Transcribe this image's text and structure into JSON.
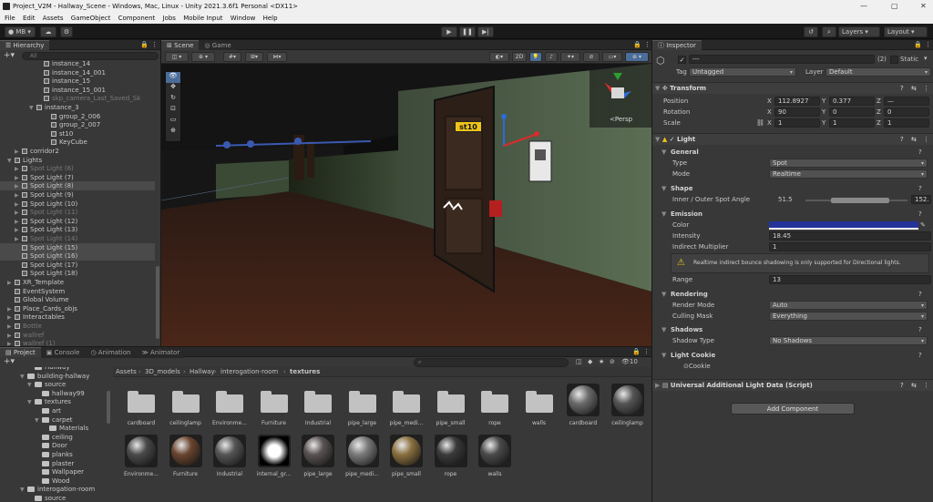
{
  "window": {
    "title": "Project_V2M - Hallway_Scene - Windows, Mac, Linux - Unity 2021.3.6f1 Personal <DX11>"
  },
  "menu": [
    "File",
    "Edit",
    "Assets",
    "GameObject",
    "Component",
    "Jobs",
    "Mobile Input",
    "Window",
    "Help"
  ],
  "toolbar": {
    "account": "MB",
    "layers": "Layers",
    "layout": "Layout"
  },
  "hierarchy": {
    "tab": "Hierarchy",
    "search_placeholder": "All",
    "rows": [
      {
        "label": "instance_14",
        "depth": 6,
        "icon": true,
        "dim": false,
        "sel": false,
        "arrow": ""
      },
      {
        "label": "instance_14_001",
        "depth": 6,
        "icon": true,
        "dim": false,
        "sel": false,
        "arrow": ""
      },
      {
        "label": "instance_15",
        "depth": 6,
        "icon": true,
        "dim": false,
        "sel": false,
        "arrow": ""
      },
      {
        "label": "instance_15_001",
        "depth": 6,
        "icon": true,
        "dim": false,
        "sel": false,
        "arrow": ""
      },
      {
        "label": "skp_camera_Last_Saved_Sk",
        "depth": 6,
        "icon": true,
        "dim": true,
        "sel": false,
        "arrow": ""
      },
      {
        "label": "instance_3",
        "depth": 5,
        "icon": true,
        "dim": false,
        "sel": false,
        "arrow": "▼"
      },
      {
        "label": "group_2_006",
        "depth": 7,
        "icon": true,
        "dim": false,
        "sel": false,
        "arrow": ""
      },
      {
        "label": "group_2_007",
        "depth": 7,
        "icon": true,
        "dim": false,
        "sel": false,
        "arrow": ""
      },
      {
        "label": "st10",
        "depth": 7,
        "icon": true,
        "dim": false,
        "sel": false,
        "arrow": ""
      },
      {
        "label": "KeyCube",
        "depth": 7,
        "icon": true,
        "dim": false,
        "sel": false,
        "arrow": ""
      },
      {
        "label": "corridor2",
        "depth": 3,
        "icon": true,
        "dim": false,
        "sel": false,
        "arrow": "▶"
      },
      {
        "label": "Lights",
        "depth": 2,
        "icon": true,
        "dim": false,
        "sel": false,
        "arrow": "▼"
      },
      {
        "label": "Spot Light (6)",
        "depth": 3,
        "icon": true,
        "dim": true,
        "sel": false,
        "arrow": "▶"
      },
      {
        "label": "Spot Light (7)",
        "depth": 3,
        "icon": true,
        "dim": false,
        "sel": false,
        "arrow": "▶"
      },
      {
        "label": "Spot Light (8)",
        "depth": 3,
        "icon": true,
        "dim": false,
        "sel": true,
        "arrow": "▶"
      },
      {
        "label": "Spot Light (9)",
        "depth": 3,
        "icon": true,
        "dim": false,
        "sel": false,
        "arrow": "▶"
      },
      {
        "label": "Spot Light (10)",
        "depth": 3,
        "icon": true,
        "dim": false,
        "sel": false,
        "arrow": "▶"
      },
      {
        "label": "Spot Light (11)",
        "depth": 3,
        "icon": true,
        "dim": true,
        "sel": false,
        "arrow": "▶"
      },
      {
        "label": "Spot Light (12)",
        "depth": 3,
        "icon": true,
        "dim": false,
        "sel": false,
        "arrow": "▶"
      },
      {
        "label": "Spot Light (13)",
        "depth": 3,
        "icon": true,
        "dim": false,
        "sel": false,
        "arrow": "▶"
      },
      {
        "label": "Spot Light (14)",
        "depth": 3,
        "icon": true,
        "dim": true,
        "sel": false,
        "arrow": "▶"
      },
      {
        "label": "Spot Light (15)",
        "depth": 3,
        "icon": true,
        "dim": false,
        "sel": true,
        "arrow": ""
      },
      {
        "label": "Spot Light (16)",
        "depth": 3,
        "icon": true,
        "dim": false,
        "sel": true,
        "arrow": ""
      },
      {
        "label": "Spot Light (17)",
        "depth": 3,
        "icon": true,
        "dim": false,
        "sel": false,
        "arrow": ""
      },
      {
        "label": "Spot Light (18)",
        "depth": 3,
        "icon": true,
        "dim": false,
        "sel": false,
        "arrow": ""
      },
      {
        "label": "XR_Template",
        "depth": 2,
        "icon": true,
        "dim": false,
        "sel": false,
        "arrow": "▶"
      },
      {
        "label": "EventSystem",
        "depth": 2,
        "icon": true,
        "dim": false,
        "sel": false,
        "arrow": ""
      },
      {
        "label": "Global Volume",
        "depth": 2,
        "icon": true,
        "dim": false,
        "sel": false,
        "arrow": ""
      },
      {
        "label": "Place_Cards_objs",
        "depth": 2,
        "icon": true,
        "dim": false,
        "sel": false,
        "arrow": "▶"
      },
      {
        "label": "Interactables",
        "depth": 2,
        "icon": true,
        "dim": false,
        "sel": false,
        "arrow": "▶"
      },
      {
        "label": "Bottle",
        "depth": 2,
        "icon": true,
        "dim": true,
        "sel": false,
        "arrow": "▶"
      },
      {
        "label": "wallref",
        "depth": 2,
        "icon": true,
        "dim": true,
        "sel": false,
        "arrow": "▶"
      },
      {
        "label": "wallref (1)",
        "depth": 2,
        "icon": true,
        "dim": true,
        "sel": false,
        "arrow": "▶"
      }
    ]
  },
  "scene": {
    "tabs": [
      "Scene",
      "Game"
    ],
    "mode_2d": "2D",
    "persp": "<Persp",
    "label_st10": "st10"
  },
  "project": {
    "tabs": [
      "Project",
      "Console",
      "Animation",
      "Animator"
    ],
    "breadcrumb": [
      "Assets",
      "3D_models",
      "Hallway",
      "interogation-room",
      "textures"
    ],
    "count": "10",
    "tree": [
      {
        "label": "Hallway",
        "depth": 3,
        "arrow": ""
      },
      {
        "label": "building-hallway",
        "depth": 2,
        "arrow": "▼"
      },
      {
        "label": "source",
        "depth": 3,
        "arrow": "▼"
      },
      {
        "label": "hallway99",
        "depth": 4,
        "arrow": ""
      },
      {
        "label": "textures",
        "depth": 3,
        "arrow": "▼"
      },
      {
        "label": "art",
        "depth": 4,
        "arrow": ""
      },
      {
        "label": "carpet",
        "depth": 4,
        "arrow": "▼"
      },
      {
        "label": "Materials",
        "depth": 5,
        "arrow": ""
      },
      {
        "label": "ceiling",
        "depth": 4,
        "arrow": ""
      },
      {
        "label": "Door",
        "depth": 4,
        "arrow": ""
      },
      {
        "label": "planks",
        "depth": 4,
        "arrow": ""
      },
      {
        "label": "plaster",
        "depth": 4,
        "arrow": ""
      },
      {
        "label": "Wallpaper",
        "depth": 4,
        "arrow": ""
      },
      {
        "label": "Wood",
        "depth": 4,
        "arrow": ""
      },
      {
        "label": "interogation-room",
        "depth": 2,
        "arrow": "▼"
      },
      {
        "label": "source",
        "depth": 3,
        "arrow": ""
      }
    ],
    "folders": [
      "cardboard",
      "ceilinglamp",
      "Environme...",
      "Furniture",
      "Industrial",
      "pipe_large",
      "pipe_medi...",
      "pipe_small",
      "rope",
      "walls"
    ],
    "materials_row1": [
      {
        "label": "cardboard",
        "color": "#6b6b6b"
      },
      {
        "label": "ceilinglamp",
        "color": "#555555"
      }
    ],
    "materials_row2": [
      {
        "label": "Environme...",
        "color": "#4a4a4a"
      },
      {
        "label": "Furniture",
        "color": "#6a4530"
      },
      {
        "label": "Industrial",
        "color": "#555555"
      },
      {
        "label": "internal_gr...",
        "color": "#000000"
      },
      {
        "label": "pipe_large",
        "color": "#5a5252"
      },
      {
        "label": "pipe_medi...",
        "color": "#7a7a7a"
      },
      {
        "label": "pipe_small",
        "color": "#8a7040"
      },
      {
        "label": "rope",
        "color": "#3a3a3a"
      },
      {
        "label": "walls",
        "color": "#4a4a4a"
      }
    ]
  },
  "inspector": {
    "tab": "Inspector",
    "object_name": "---",
    "badge": "(2)",
    "static_label": "Static",
    "tag_label": "Tag",
    "tag_value": "Untagged",
    "layer_label": "Layer",
    "layer_value": "Default",
    "transform": {
      "title": "Transform",
      "rows": [
        {
          "label": "Position",
          "x": "112.8927",
          "y": "0.377",
          "z": "—"
        },
        {
          "label": "Rotation",
          "x": "90",
          "y": "0",
          "z": "0"
        },
        {
          "label": "Scale",
          "x": "1",
          "y": "1",
          "z": "1"
        }
      ]
    },
    "light": {
      "title": "Light",
      "general": "General",
      "type_label": "Type",
      "type_value": "Spot",
      "mode_label": "Mode",
      "mode_value": "Realtime",
      "shape": "Shape",
      "angle_label": "Inner / Outer Spot Angle",
      "angle_inner": "51.5",
      "angle_outer": "152.",
      "emission": "Emission",
      "color_label": "Color",
      "color_value": "#23339a",
      "intensity_label": "Intensity",
      "intensity_value": "18.45",
      "indirect_label": "Indirect Multiplier",
      "indirect_value": "1",
      "warning": "Realtime indirect bounce shadowing is only supported for Directional lights.",
      "range_label": "Range",
      "range_value": "13",
      "rendering": "Rendering",
      "render_mode_label": "Render Mode",
      "render_mode_value": "Auto",
      "culling_label": "Culling Mask",
      "culling_value": "Everything",
      "shadows": "Shadows",
      "shadow_type_label": "Shadow Type",
      "shadow_type_value": "No Shadows",
      "cookie": "Light Cookie",
      "cookie_value": "Cookie"
    },
    "urp": {
      "title": "Universal Additional Light Data (Script)"
    },
    "add_component": "Add Component"
  }
}
